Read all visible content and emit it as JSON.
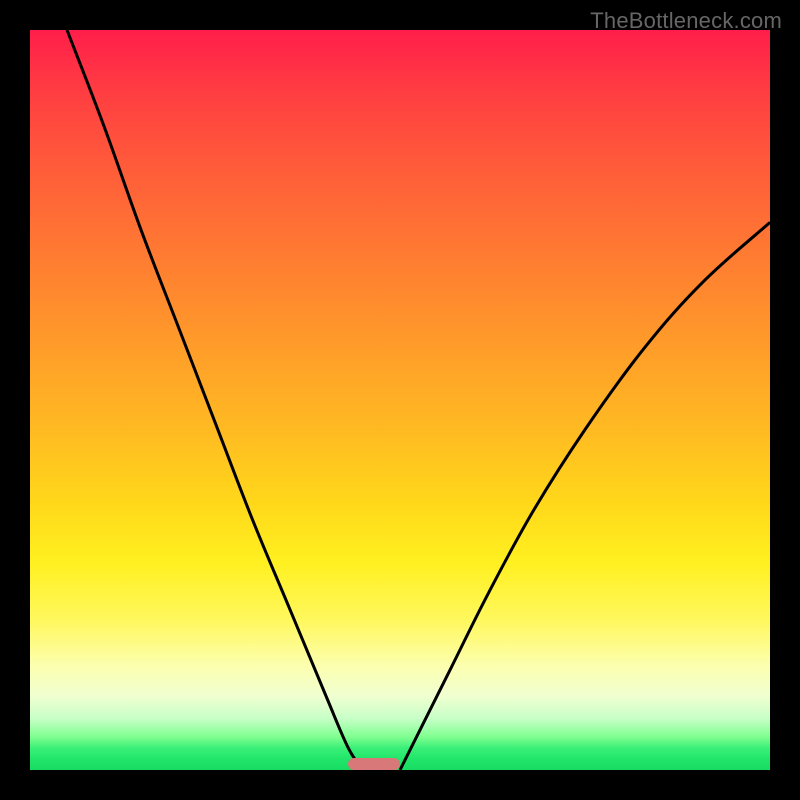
{
  "watermark": "TheBottleneck.com",
  "chart_data": {
    "type": "line",
    "title": "",
    "xlabel": "",
    "ylabel": "",
    "xlim": [
      0,
      100
    ],
    "ylim": [
      0,
      100
    ],
    "grid": false,
    "legend": false,
    "background_gradient": {
      "stops": [
        {
          "pos": 0,
          "color": "#ff1e4a"
        },
        {
          "pos": 50,
          "color": "#ffc020"
        },
        {
          "pos": 85,
          "color": "#fcffb0"
        },
        {
          "pos": 100,
          "color": "#18dc62"
        }
      ]
    },
    "series": [
      {
        "name": "left-curve",
        "x": [
          5,
          10,
          15,
          20,
          25,
          30,
          35,
          40,
          43,
          45
        ],
        "values": [
          100,
          87,
          73,
          60,
          47,
          34,
          22,
          10,
          3,
          0
        ]
      },
      {
        "name": "right-curve",
        "x": [
          50,
          53,
          57,
          62,
          68,
          75,
          83,
          91,
          100
        ],
        "values": [
          0,
          6,
          14,
          24,
          35,
          46,
          57,
          66,
          74
        ]
      }
    ],
    "marker": {
      "x_start": 43,
      "x_end": 50,
      "y": 0,
      "color": "#d87878"
    }
  }
}
